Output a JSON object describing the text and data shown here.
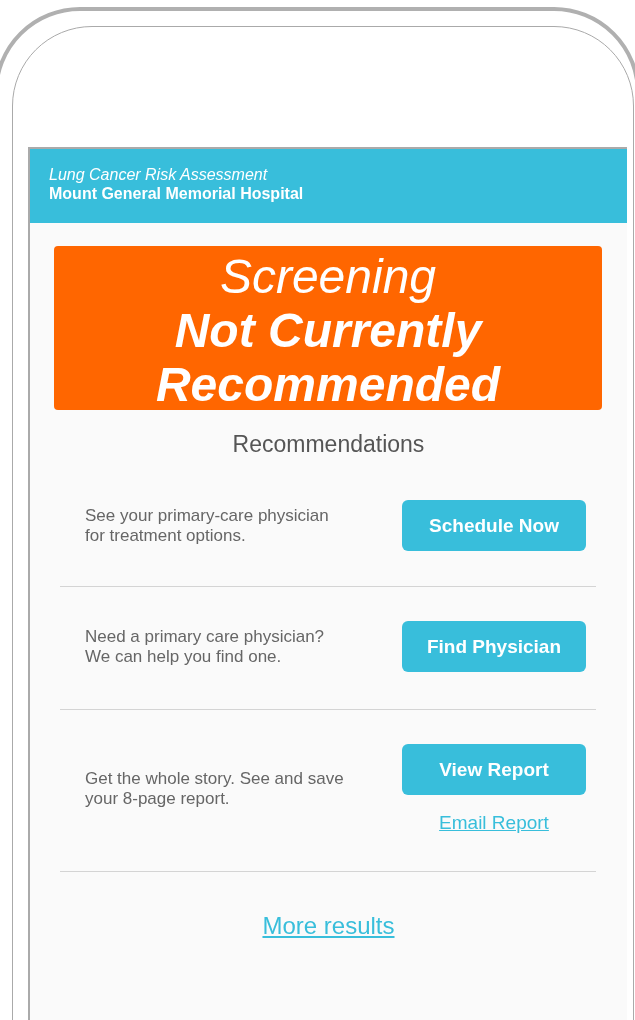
{
  "header": {
    "subtitle": "Lung Cancer Risk Assessment",
    "title": "Mount General Memorial Hospital"
  },
  "status": {
    "label": "Screening",
    "headline": "Not Currently Recommended"
  },
  "section_title": "Recommendations",
  "recommendations": [
    {
      "text": "See your primary-care physician for treatment options.",
      "button": "Schedule Now"
    },
    {
      "text": "Need a primary care physician? We can help you find one.",
      "button": "Find Physician"
    },
    {
      "text": "Get the whole story. See and save your 8-page report.",
      "button": "View Report",
      "link": "Email Report"
    }
  ],
  "more_link": "More results"
}
